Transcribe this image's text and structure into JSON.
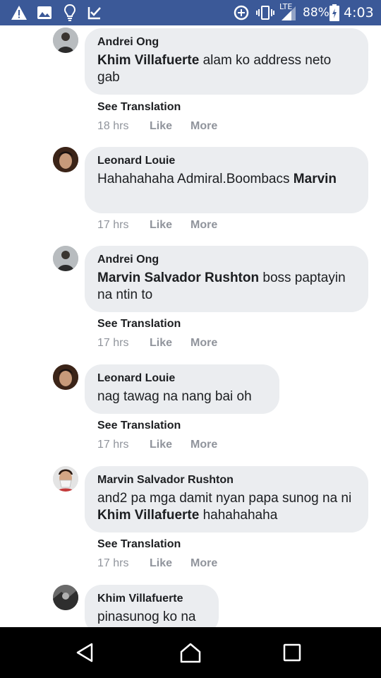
{
  "status_bar": {
    "icons": [
      "warning-icon",
      "image-icon",
      "lightbulb-icon",
      "check-icon",
      "data-saver-icon",
      "vibrate-icon",
      "lte-signal-icon",
      "battery-icon"
    ],
    "network": "LTE",
    "battery": "88%",
    "time": "4:03"
  },
  "labels": {
    "see_translation": "See Translation",
    "like": "Like",
    "more": "More"
  },
  "comments": [
    {
      "author": "Andrei Ong",
      "mention": "Khim Villafuerte",
      "text": " alam ko address neto gab",
      "time": "18 hrs"
    },
    {
      "author": "Leonard Louie",
      "text": "Hahahahaha Admiral.Boombacs ",
      "mention": "Marvin",
      "time": "17 hrs"
    },
    {
      "author": "Andrei Ong",
      "mention": "Marvin Salvador Rushton",
      "text": " boss paptayin na ntin to",
      "time": "17 hrs"
    },
    {
      "author": "Leonard Louie",
      "text": "nag tawag na nang bai oh",
      "time": "17 hrs"
    },
    {
      "author": "Marvin Salvador Rushton",
      "text": "and2 pa mga damit nyan papa sunog na ni ",
      "mention": "Khim Villafuerte",
      "text_after": " hahahahaha",
      "time": "17 hrs"
    },
    {
      "author": "Khim Villafuerte",
      "text": "pinasunog ko na"
    }
  ],
  "nav_bar": {
    "icons": [
      "back-icon",
      "home-icon",
      "recents-icon"
    ]
  }
}
